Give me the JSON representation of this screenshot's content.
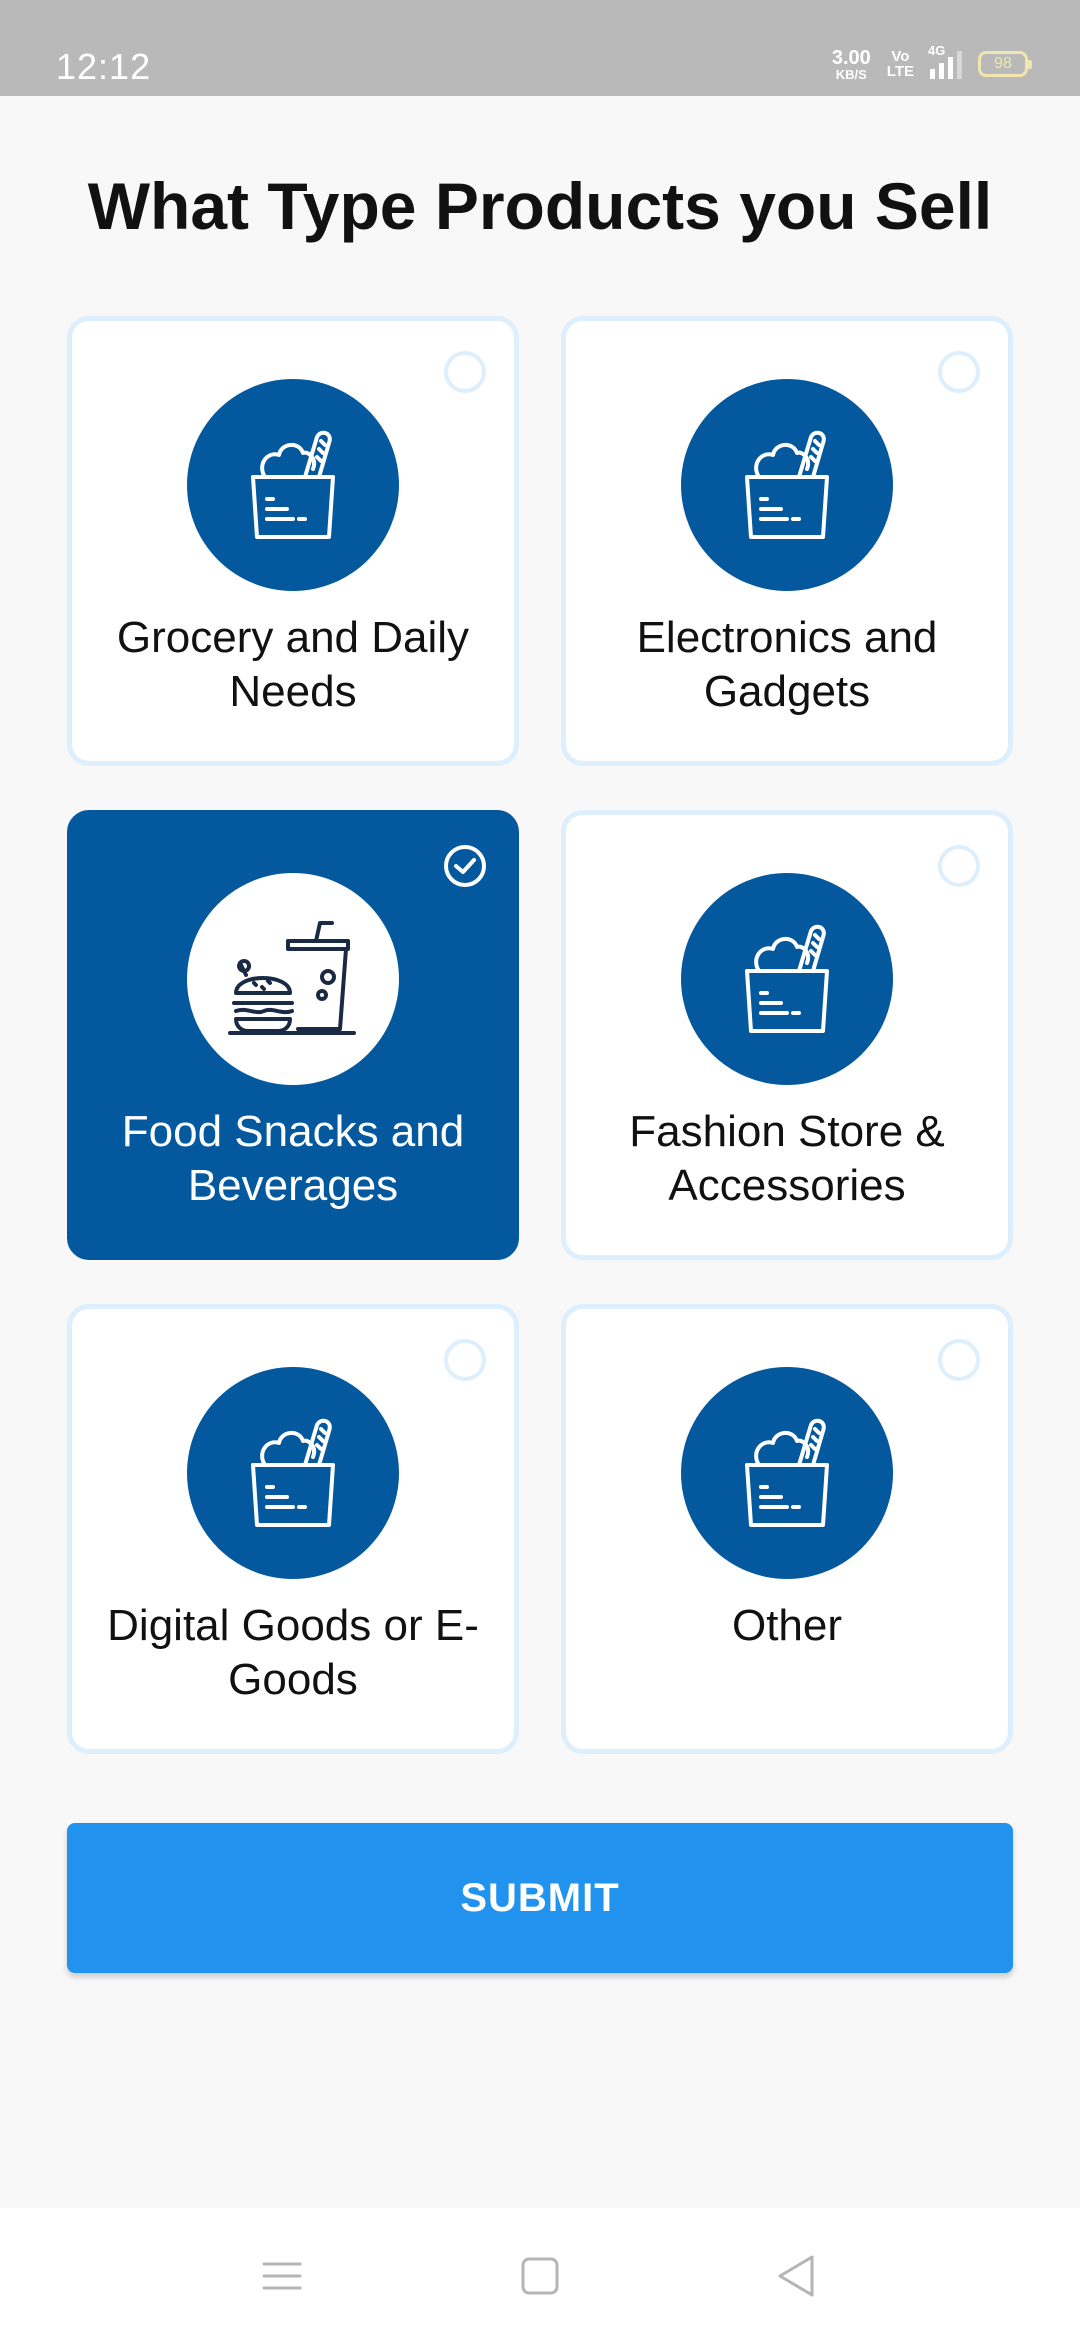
{
  "status_bar": {
    "time": "12:12",
    "net_speed_value": "3.00",
    "net_speed_unit": "KB/S",
    "volte_top": "Vo",
    "volte_bottom": "LTE",
    "network": "4G",
    "battery": "98"
  },
  "page": {
    "title": "What Type Products you Sell"
  },
  "categories": [
    {
      "label": "Grocery and Daily Needs",
      "icon": "grocery-bag-icon",
      "selected": false
    },
    {
      "label": "Electronics and Gadgets",
      "icon": "grocery-bag-icon",
      "selected": false
    },
    {
      "label": "Food Snacks and Beverages",
      "icon": "burger-drink-icon",
      "selected": true
    },
    {
      "label": "Fashion Store & Accessories",
      "icon": "grocery-bag-icon",
      "selected": false
    },
    {
      "label": "Digital Goods or E-Goods",
      "icon": "grocery-bag-icon",
      "selected": false
    },
    {
      "label": "Other",
      "icon": "grocery-bag-icon",
      "selected": false
    }
  ],
  "submit": {
    "label": "SUBMIT"
  },
  "nav": {
    "items": [
      "menu-icon",
      "home-square-icon",
      "back-triangle-icon"
    ]
  },
  "colors": {
    "primary": "#04599e",
    "accent": "#2193ee",
    "card_border": "#ddeefc",
    "background": "#f8f8f8"
  }
}
